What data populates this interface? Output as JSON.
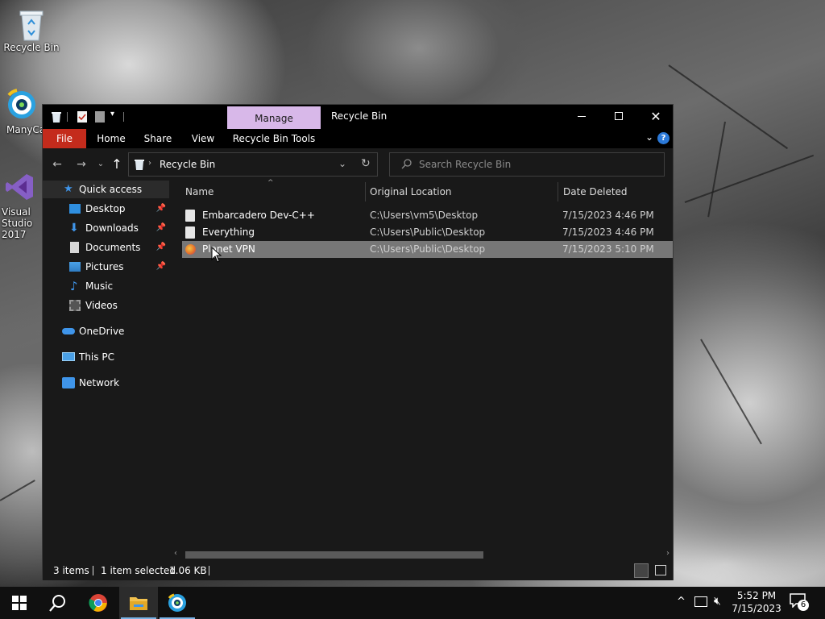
{
  "desktop": {
    "icons": [
      {
        "label": "Recycle Bin"
      },
      {
        "label": "ManyCam"
      },
      {
        "label": "Visual Studio 2017"
      }
    ]
  },
  "window": {
    "title": "Recycle Bin",
    "manage_tab": "Manage",
    "ribbon_tabs": [
      "File",
      "Home",
      "Share",
      "View",
      "Recycle Bin Tools"
    ],
    "address_path": "Recycle Bin",
    "search_placeholder": "Search Recycle Bin",
    "nav_items": [
      {
        "label": "Quick access"
      },
      {
        "label": "Desktop"
      },
      {
        "label": "Downloads"
      },
      {
        "label": "Documents"
      },
      {
        "label": "Pictures"
      },
      {
        "label": "Music"
      },
      {
        "label": "Videos"
      },
      {
        "label": "OneDrive"
      },
      {
        "label": "This PC"
      },
      {
        "label": "Network"
      }
    ],
    "columns": [
      "Name",
      "Original Location",
      "Date Deleted"
    ],
    "files": [
      {
        "name": "Embarcadero Dev-C++",
        "location": "C:\\Users\\vm5\\Desktop",
        "date": "7/15/2023 4:46 PM"
      },
      {
        "name": "Everything",
        "location": "C:\\Users\\Public\\Desktop",
        "date": "7/15/2023 4:46 PM"
      },
      {
        "name": "Planet VPN",
        "location": "C:\\Users\\Public\\Desktop",
        "date": "7/15/2023 5:10 PM"
      }
    ],
    "status": {
      "items": "3 items",
      "selected": "1 item selected",
      "size": "1.06 KB"
    }
  },
  "taskbar": {
    "time": "5:52 PM",
    "date": "7/15/2023",
    "notification_count": "6"
  },
  "colors": {
    "file_tab": "#c42b1c",
    "manage_tab": "#d8b8e9",
    "selection": "#777777",
    "window_bg": "#191919"
  }
}
